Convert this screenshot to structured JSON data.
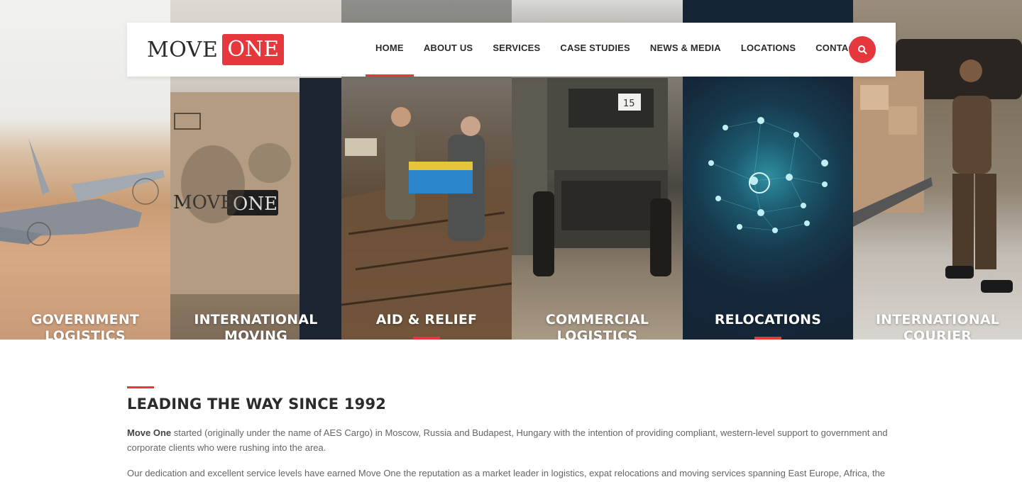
{
  "brand": {
    "logo_left": "MOVE",
    "logo_right": "ONE",
    "accent_color": "#e5373c"
  },
  "nav": {
    "items": [
      {
        "label": "HOME",
        "active": true
      },
      {
        "label": "ABOUT US"
      },
      {
        "label": "SERVICES"
      },
      {
        "label": "CASE STUDIES"
      },
      {
        "label": "NEWS & MEDIA"
      },
      {
        "label": "LOCATIONS"
      },
      {
        "label": "CONTACT"
      }
    ],
    "search_icon": "search-icon"
  },
  "hero": {
    "panels": [
      {
        "title": "GOVERNMENT LOGISTICS",
        "image": "military-plane"
      },
      {
        "title": "INTERNATIONAL MOVING",
        "image": "moving-box"
      },
      {
        "title": "AID & RELIEF",
        "image": "aid-workers"
      },
      {
        "title": "COMMERCIAL LOGISTICS",
        "image": "truck"
      },
      {
        "title": "RELOCATIONS",
        "image": "network-globe",
        "active": true
      },
      {
        "title": "INTERNATIONAL COURIER",
        "image": "courier"
      }
    ]
  },
  "intro": {
    "heading": "LEADING THE WAY SINCE 1992",
    "para1_bold": "Move One",
    "para1_rest": " started (originally under the name of AES Cargo) in Moscow, Russia and Budapest, Hungary with the intention of providing compliant, western-level support to government and corporate clients who were rushing into the area.",
    "para2": "Our dedication and excellent service levels have earned Move One the reputation as a market leader in logistics, expat relocations and moving services spanning East Europe, Africa, the"
  }
}
